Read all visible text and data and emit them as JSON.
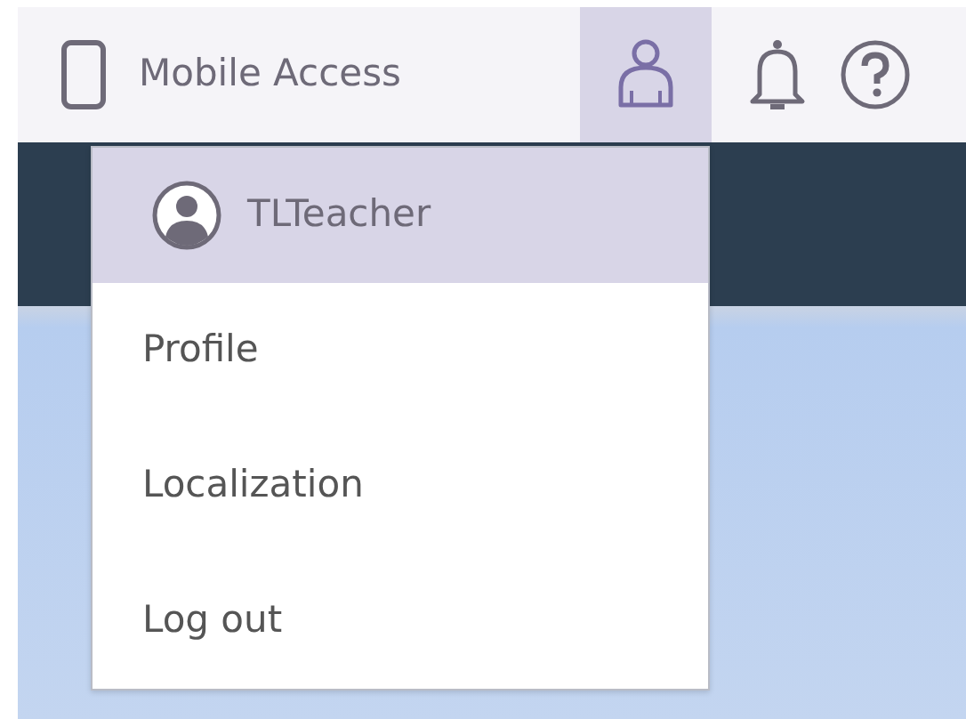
{
  "topbar": {
    "mobile_access": {
      "label": "Mobile Access"
    },
    "user_menu": {
      "expanded": true
    }
  },
  "dropdown": {
    "items": [
      {
        "kind": "user",
        "label": "TLTeacher",
        "selected": true
      },
      {
        "kind": "link",
        "label": "Profile",
        "selected": false
      },
      {
        "kind": "link",
        "label": "Localization",
        "selected": false
      },
      {
        "kind": "link",
        "label": "Log out",
        "selected": false
      }
    ]
  }
}
